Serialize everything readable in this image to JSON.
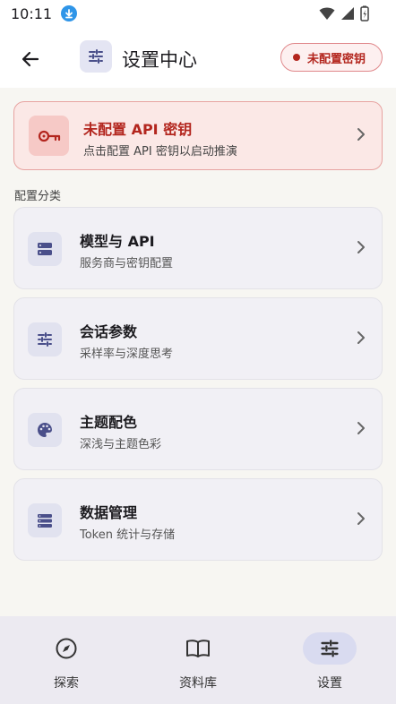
{
  "status_bar": {
    "time": "10:11"
  },
  "app_bar": {
    "title": "设置中心",
    "chip_label": "未配置密钥"
  },
  "alert": {
    "title": "未配置 API 密钥",
    "subtitle": "点击配置 API 密钥以启动推演"
  },
  "section": {
    "label": "配置分类"
  },
  "menu": [
    {
      "title": "模型与 API",
      "subtitle": "服务商与密钥配置",
      "icon": "server-icon"
    },
    {
      "title": "会话参数",
      "subtitle": "采样率与深度思考",
      "icon": "sliders-icon"
    },
    {
      "title": "主题配色",
      "subtitle": "深浅与主题色彩",
      "icon": "palette-icon"
    },
    {
      "title": "数据管理",
      "subtitle": "Token 统计与存储",
      "icon": "storage-icon"
    }
  ],
  "nav": [
    {
      "label": "探索",
      "icon": "compass-icon",
      "active": false
    },
    {
      "label": "资料库",
      "icon": "book-icon",
      "active": false
    },
    {
      "label": "设置",
      "icon": "sliders-icon",
      "active": true
    }
  ],
  "colors": {
    "accent": "#b3261e",
    "icon_tint": "#4a4f8a"
  }
}
